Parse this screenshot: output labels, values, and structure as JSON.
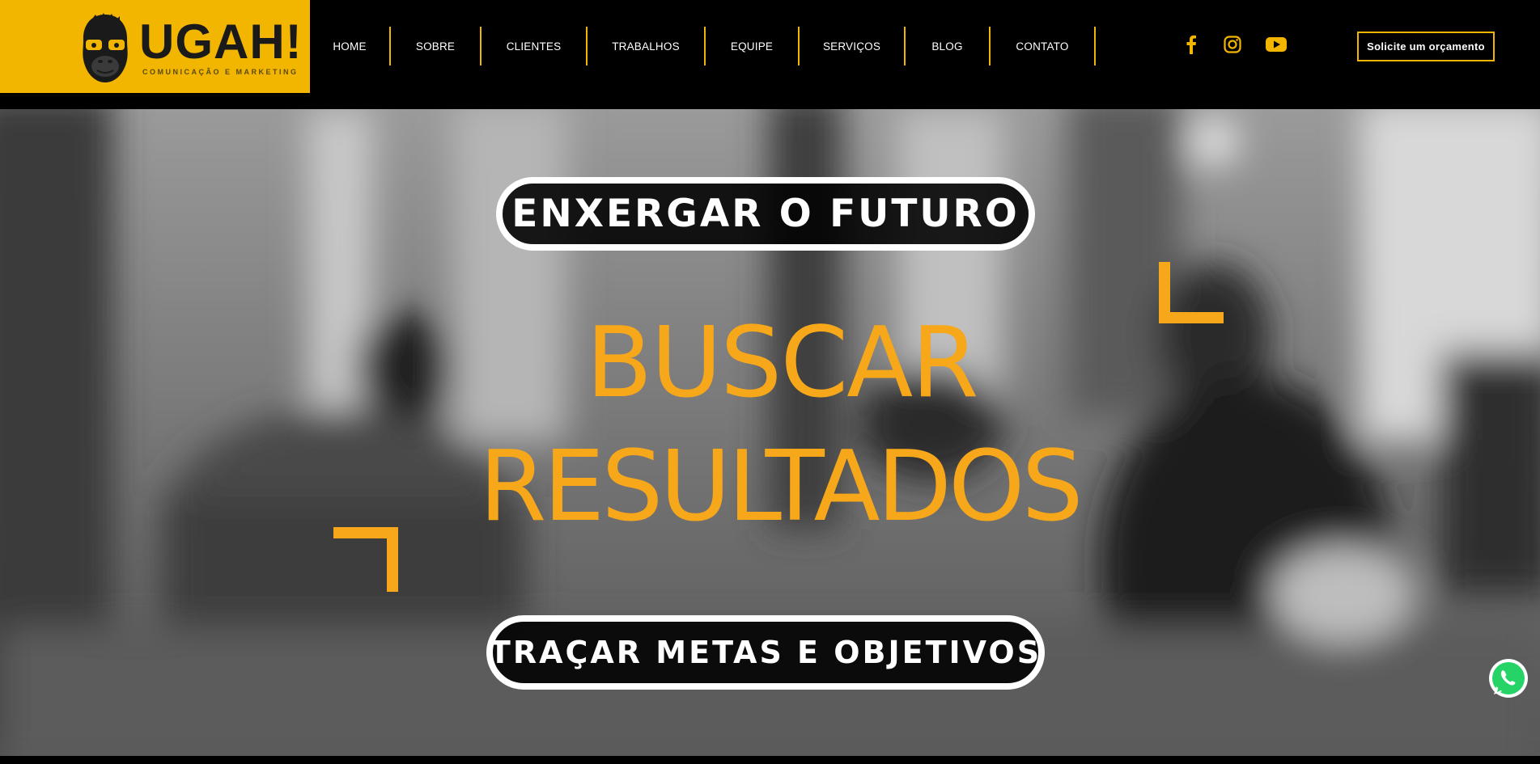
{
  "brand": {
    "wordmark": "UGAH!",
    "tagline": "COMUNICAÇÃO E MARKETING",
    "logo_icon": "ape-with-glasses-icon"
  },
  "nav": {
    "items": [
      {
        "label": "HOME"
      },
      {
        "label": "SOBRE"
      },
      {
        "label": "CLIENTES"
      },
      {
        "label": "TRABALHOS"
      },
      {
        "label": "EQUIPE"
      },
      {
        "label": "SERVIÇOS"
      },
      {
        "label": "BLOG"
      },
      {
        "label": "CONTATO"
      }
    ]
  },
  "social": {
    "icons": [
      "facebook-icon",
      "instagram-icon",
      "youtube-icon"
    ]
  },
  "cta": {
    "quote_label": "Solicite um orçamento"
  },
  "hero": {
    "pill_top": "ENXERGAR O FUTURO",
    "headline_line1": "BUSCAR",
    "headline_line2": "RESULTADOS",
    "pill_bottom": "TRAÇAR METAS E OBJETIVOS"
  },
  "floating": {
    "whatsapp_icon": "whatsapp-icon"
  },
  "colors": {
    "brand_yellow": "#f2b600",
    "headline_orange": "#f7a71a",
    "background": "#000000",
    "text": "#ffffff"
  }
}
